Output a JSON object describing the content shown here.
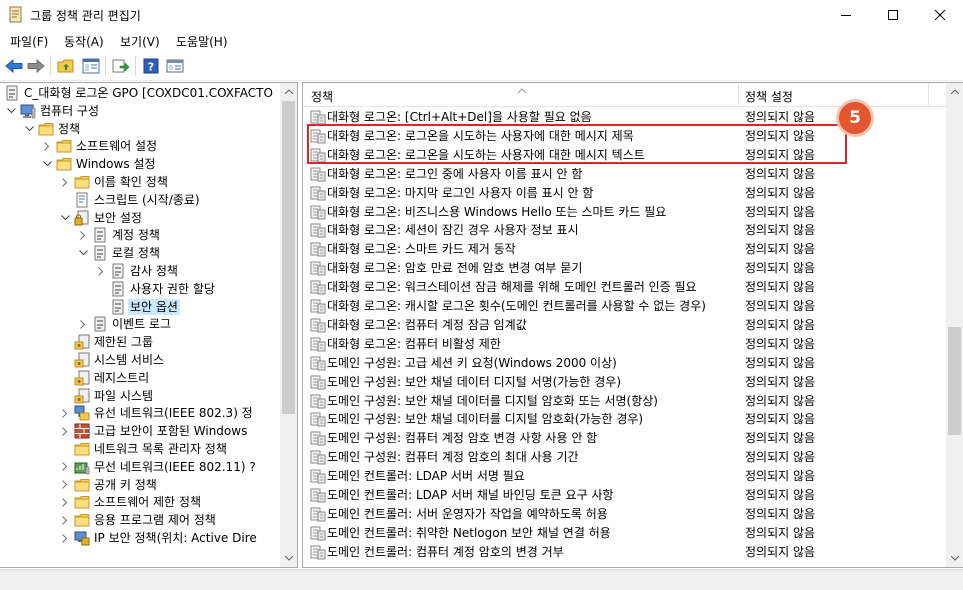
{
  "window": {
    "title": "그룹 정책 관리 편집기"
  },
  "menu": {
    "items": [
      "파일(F)",
      "동작(A)",
      "보기(V)",
      "도움말(H)"
    ]
  },
  "toolbar": {
    "buttons": [
      "back-icon",
      "forward-icon",
      "up-folder-icon",
      "show-hide-tree-icon",
      "export-list-icon",
      "help-icon",
      "properties-icon"
    ]
  },
  "tree": {
    "items": [
      {
        "label": "C_대화형 로그온 GPO [COXDC01.COXFACTO",
        "icon": "policy-doc-icon",
        "chevron": "none"
      },
      {
        "label": "컴퓨터 구성",
        "icon": "computer-icon",
        "chevron": "down"
      },
      {
        "label": "정책",
        "icon": "folder-icon",
        "chevron": "down"
      },
      {
        "label": "소프트웨어 설정",
        "icon": "folder-icon",
        "chevron": "right"
      },
      {
        "label": "Windows 설정",
        "icon": "folder-icon",
        "chevron": "down"
      },
      {
        "label": "이름 확인 정책",
        "icon": "folder-icon",
        "chevron": "right"
      },
      {
        "label": "스크립트 (시작/종료)",
        "icon": "script-icon",
        "chevron": "none"
      },
      {
        "label": "보안 설정",
        "icon": "security-icon",
        "chevron": "down"
      },
      {
        "label": "계정 정책",
        "icon": "policy-doc-icon",
        "chevron": "right"
      },
      {
        "label": "로컬 정책",
        "icon": "policy-doc-icon",
        "chevron": "down"
      },
      {
        "label": "감사 정책",
        "icon": "policy-doc-icon",
        "chevron": "right"
      },
      {
        "label": "사용자 권한 할당",
        "icon": "policy-doc-icon",
        "chevron": "none"
      },
      {
        "label": "보안 옵션",
        "icon": "policy-doc-icon",
        "chevron": "none",
        "selected": true
      },
      {
        "label": "이벤트 로그",
        "icon": "policy-doc-icon",
        "chevron": "right"
      },
      {
        "label": "제한된 그룹",
        "icon": "restricted-groups-icon",
        "chevron": "none"
      },
      {
        "label": "시스템 서비스",
        "icon": "restricted-groups-icon",
        "chevron": "none"
      },
      {
        "label": "레지스트리",
        "icon": "restricted-groups-icon",
        "chevron": "none"
      },
      {
        "label": "파일 시스템",
        "icon": "restricted-groups-icon",
        "chevron": "none"
      },
      {
        "label": "유선 네트워크(IEEE 802.3) 정",
        "icon": "network-icon",
        "chevron": "right"
      },
      {
        "label": "고급 보안이 포함된 Windows",
        "icon": "firewall-icon",
        "chevron": "right"
      },
      {
        "label": "네트워크 목록 관리자 정책",
        "icon": "folder-icon",
        "chevron": "none"
      },
      {
        "label": "무선 네트워크(IEEE 802.11) ?",
        "icon": "wireless-icon",
        "chevron": "right"
      },
      {
        "label": "공개 키 정책",
        "icon": "folder-icon",
        "chevron": "right"
      },
      {
        "label": "소프트웨어 제한 정책",
        "icon": "folder-icon",
        "chevron": "right"
      },
      {
        "label": "응용 프로그램 제어 정책",
        "icon": "folder-icon",
        "chevron": "right"
      },
      {
        "label": "IP 보안 정책(위치: Active Dire",
        "icon": "ip-security-icon",
        "chevron": "right"
      }
    ]
  },
  "list": {
    "columns": {
      "policy": "정책",
      "setting": "정책 설정"
    },
    "step_badge": "5",
    "rows": [
      {
        "policy": "대화형 로그온: [Ctrl+Alt+Del]을 사용할 필요 없음",
        "setting": "정의되지 않음"
      },
      {
        "policy": "대화형 로그온: 로그온을 시도하는 사용자에 대한 메시지 제목",
        "setting": "정의되지 않음"
      },
      {
        "policy": "대화형 로그온: 로그온을 시도하는 사용자에 대한 메시지 텍스트",
        "setting": "정의되지 않음"
      },
      {
        "policy": "대화형 로그온: 로그인 중에 사용자 이름 표시 안 함",
        "setting": "정의되지 않음"
      },
      {
        "policy": "대화형 로그온: 마지막 로그인 사용자 이름 표시 안 함",
        "setting": "정의되지 않음"
      },
      {
        "policy": "대화형 로그온: 비즈니스용 Windows Hello 또는 스마트 카드 필요",
        "setting": "정의되지 않음"
      },
      {
        "policy": "대화형 로그온: 세션이 잠긴 경우 사용자 정보 표시",
        "setting": "정의되지 않음"
      },
      {
        "policy": "대화형 로그온: 스마트 카드 제거 동작",
        "setting": "정의되지 않음"
      },
      {
        "policy": "대화형 로그온: 암호 만료 전에 암호 변경 여부 묻기",
        "setting": "정의되지 않음"
      },
      {
        "policy": "대화형 로그온: 워크스테이션 잠금 해제를 위해 도메인 컨트롤러 인증 필요",
        "setting": "정의되지 않음"
      },
      {
        "policy": "대화형 로그온: 캐시할 로그온 횟수(도메인 컨트롤러를 사용할 수 없는 경우)",
        "setting": "정의되지 않음"
      },
      {
        "policy": "대화형 로그온: 컴퓨터 계정 잠금 임계값",
        "setting": "정의되지 않음"
      },
      {
        "policy": "대화형 로그온: 컴퓨터 비활성 제한",
        "setting": "정의되지 않음"
      },
      {
        "policy": "도메인 구성원: 고급 세션 키 요청(Windows 2000 이상)",
        "setting": "정의되지 않음"
      },
      {
        "policy": "도메인 구성원: 보안 채널 데이터 디지털 서명(가능한 경우)",
        "setting": "정의되지 않음"
      },
      {
        "policy": "도메인 구성원: 보안 채널 데이터를 디지털 암호화 또는 서명(항상)",
        "setting": "정의되지 않음"
      },
      {
        "policy": "도메인 구성원: 보안 채널 데이터를 디지털 암호화(가능한 경우)",
        "setting": "정의되지 않음"
      },
      {
        "policy": "도메인 구성원: 컴퓨터 계정 암호 변경 사항 사용 안 함",
        "setting": "정의되지 않음"
      },
      {
        "policy": "도메인 구성원: 컴퓨터 계정 암호의 최대 사용 기간",
        "setting": "정의되지 않음"
      },
      {
        "policy": "도메인 컨트롤러: LDAP 서버 서명 필요",
        "setting": "정의되지 않음"
      },
      {
        "policy": "도메인 컨트롤러: LDAP 서버 채널 바인딩 토큰 요구 사항",
        "setting": "정의되지 않음"
      },
      {
        "policy": "도메인 컨트롤러: 서버 운영자가 작업을 예약하도록 허용",
        "setting": "정의되지 않음"
      },
      {
        "policy": "도메인 컨트롤러: 취약한 Netlogon 보안 채널 연결 허용",
        "setting": "정의되지 않음"
      },
      {
        "policy": "도메인 컨트롤러: 컴퓨터 계정 암호의 변경 거부",
        "setting": "정의되지 않음"
      }
    ]
  }
}
